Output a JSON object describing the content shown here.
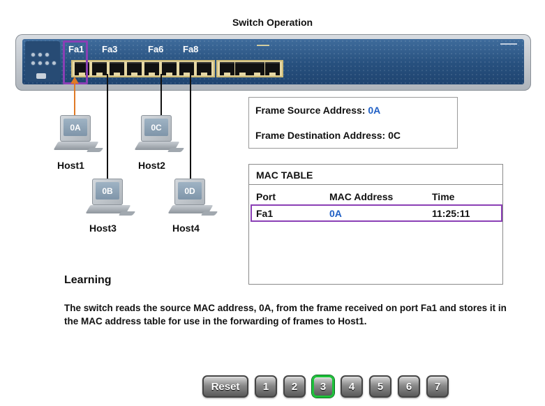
{
  "title": "Switch Operation",
  "switch": {
    "port_labels": [
      "Fa1",
      "Fa3",
      "Fa6",
      "Fa8"
    ],
    "highlighted_port": "Fa1",
    "highlight_color": "#8a3fb5",
    "active_link_color": "#e07a26"
  },
  "hosts": [
    {
      "name": "Host1",
      "mac": "0A"
    },
    {
      "name": "Host2",
      "mac": "0C"
    },
    {
      "name": "Host3",
      "mac": "0B"
    },
    {
      "name": "Host4",
      "mac": "0D"
    }
  ],
  "frame": {
    "source_label": "Frame Source Address:",
    "source_value": "0A",
    "destination_label": "Frame Destination Address:",
    "destination_value": "0C"
  },
  "mac_table": {
    "title": "MAC TABLE",
    "columns": [
      "Port",
      "MAC Address",
      "Time"
    ],
    "rows": [
      {
        "port": "Fa1",
        "mac": "0A",
        "time": "11:25:11"
      }
    ]
  },
  "section_heading": "Learning",
  "description": "The switch reads the source MAC address, 0A, from the frame received on port Fa1 and stores it in the MAC address table for use in the forwarding of frames to Host1.",
  "nav": {
    "reset_label": "Reset",
    "steps": [
      "1",
      "2",
      "3",
      "4",
      "5",
      "6",
      "7"
    ],
    "active_step": "3"
  }
}
